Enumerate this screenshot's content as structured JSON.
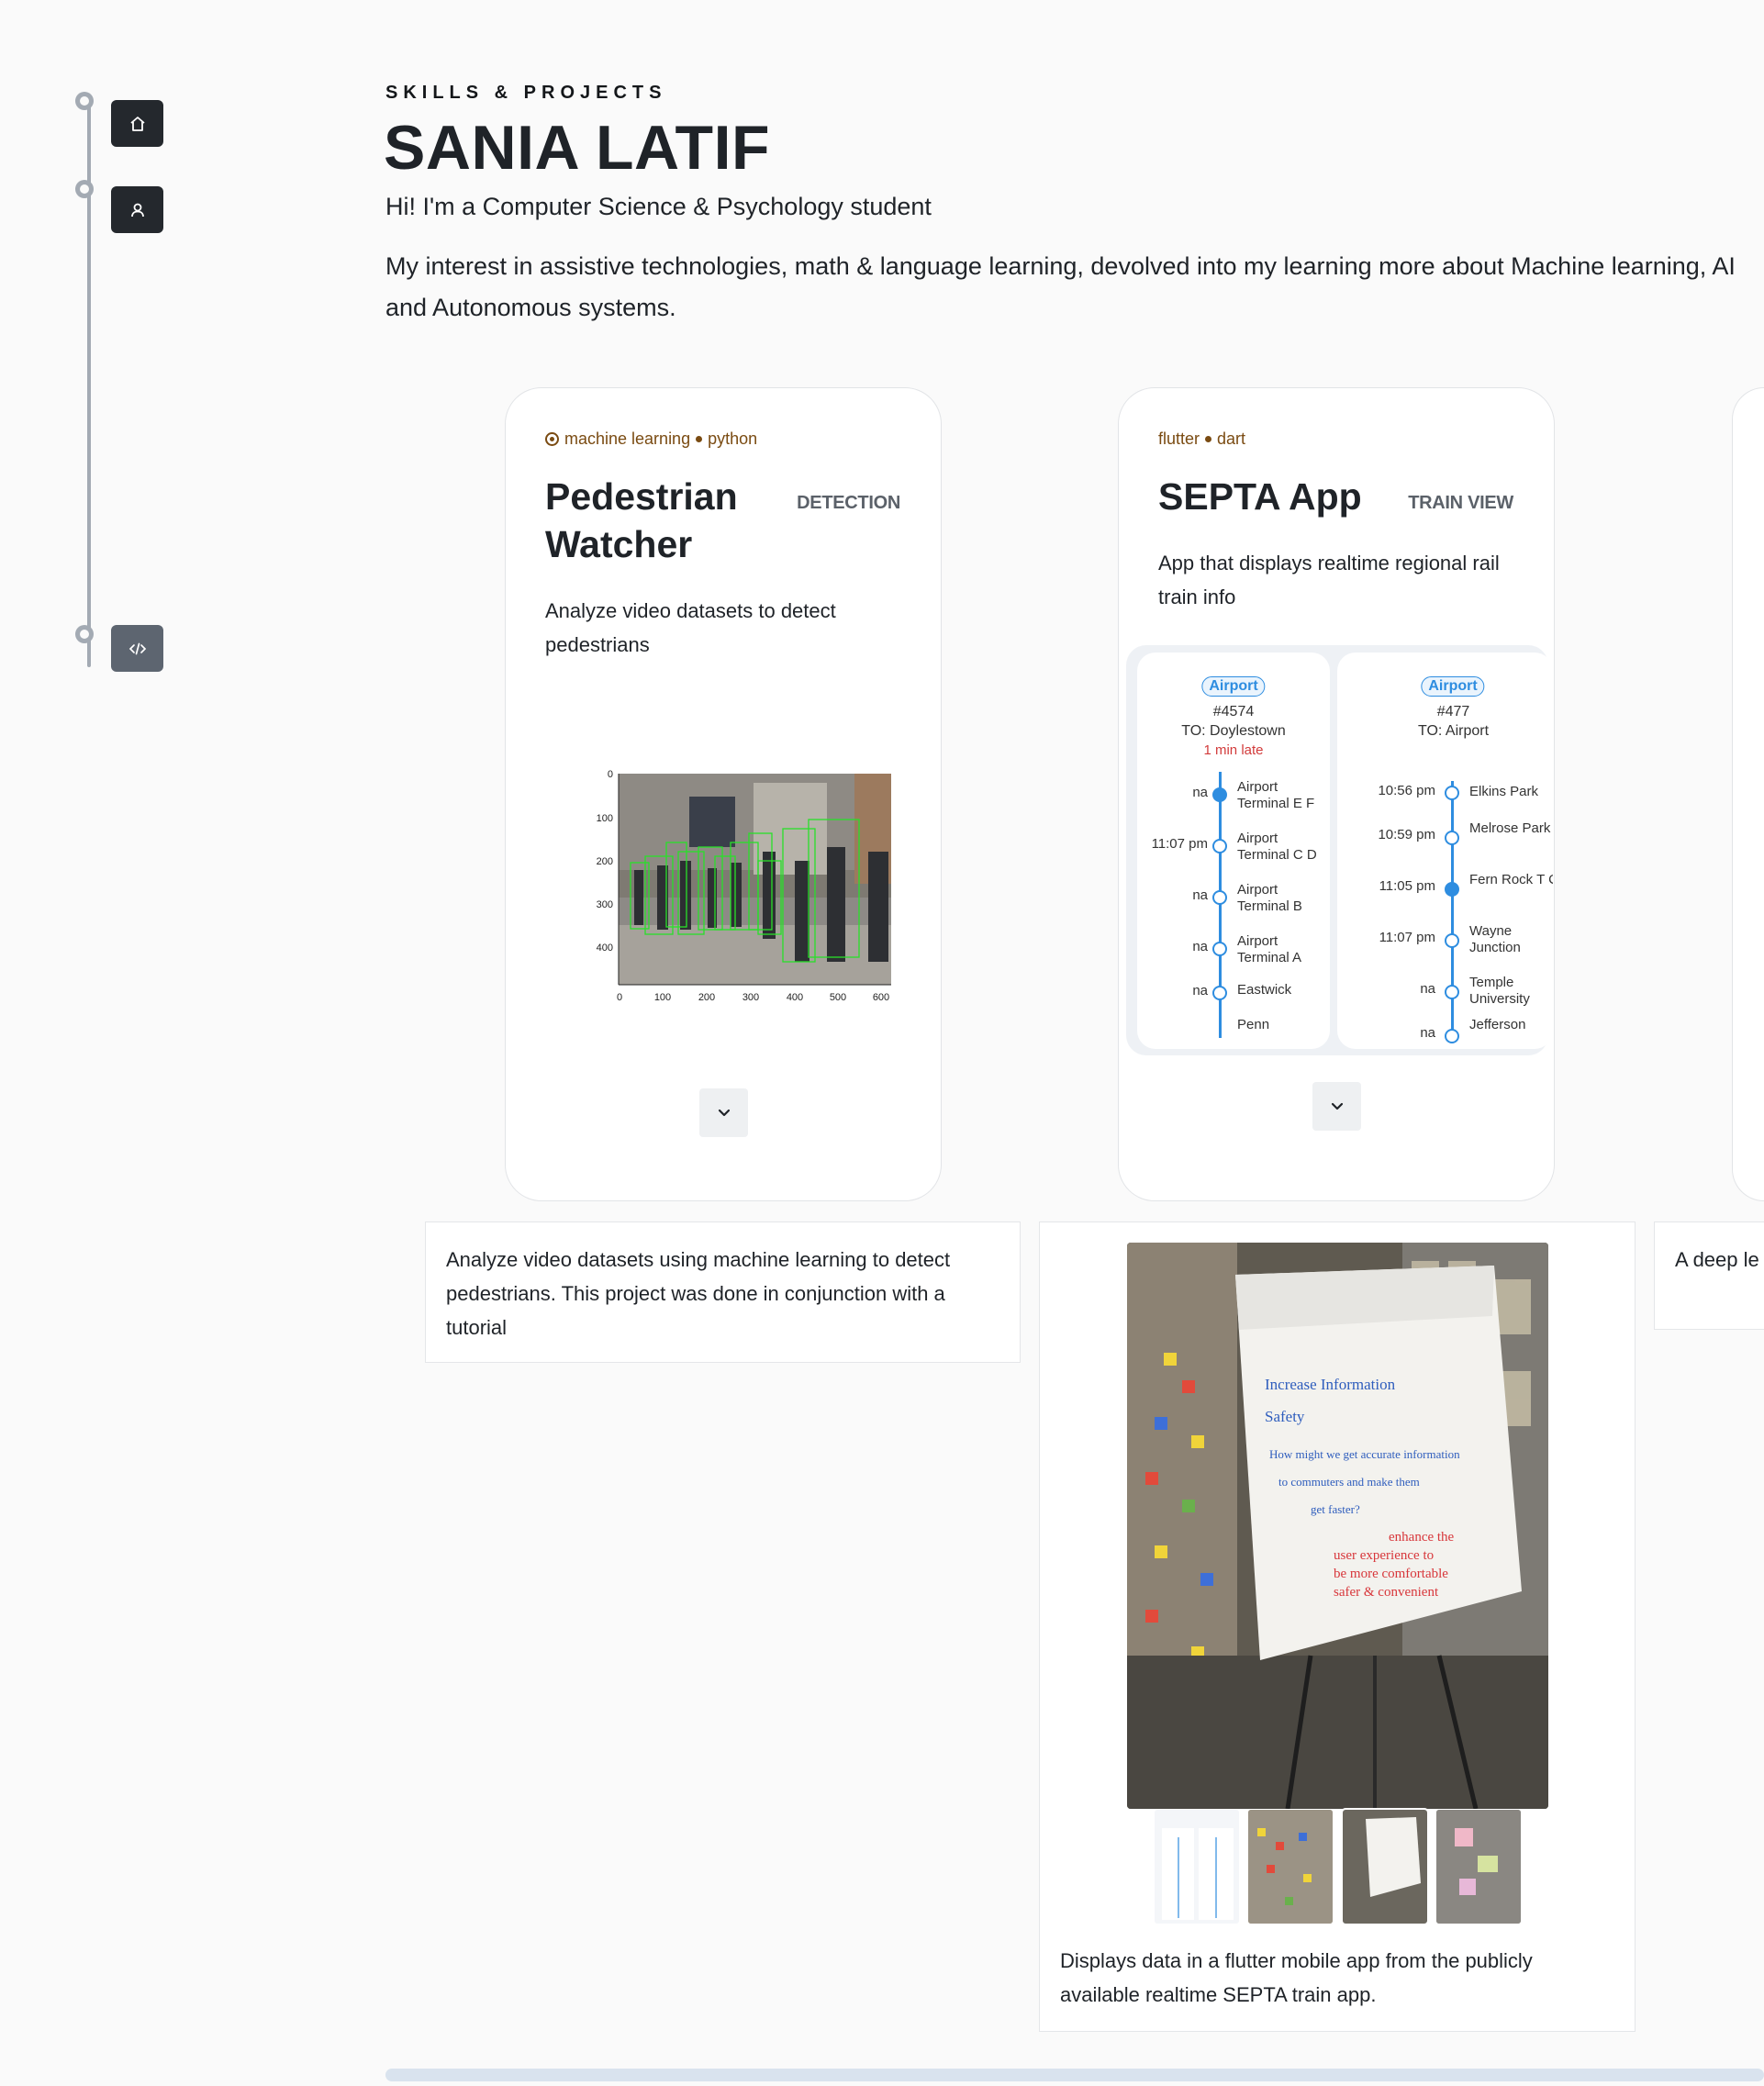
{
  "nav": {
    "items": [
      {
        "name": "home",
        "icon": "home-icon"
      },
      {
        "name": "profile",
        "icon": "person-icon"
      },
      {
        "name": "projects",
        "icon": "code-icon"
      }
    ]
  },
  "header": {
    "kicker": "SKILLS & PROJECTS",
    "title": "SANIA LATIF",
    "subtitle": "Hi! I'm a Computer Science & Psychology student",
    "intro": "My interest in assistive technologies, math & language learning, devolved into my learning more about Machine learning, AI and Autonomous systems."
  },
  "projects": [
    {
      "tags": [
        "machine learning",
        "python"
      ],
      "title": "Pedestrian Watcher",
      "badge": "DETECTION",
      "summary": "Analyze video datasets to detect pedestrians",
      "detail": "Analyze video datasets using machine learning to detect pedestrians. This project was done in conjunction with a tutorial",
      "plot": {
        "y_ticks": [
          "0",
          "100",
          "200",
          "300",
          "400"
        ],
        "x_ticks": [
          "0",
          "100",
          "200",
          "300",
          "400",
          "500",
          "600"
        ]
      }
    },
    {
      "tags": [
        "flutter",
        "dart"
      ],
      "title": "SEPTA App",
      "badge": "TRAIN VIEW",
      "summary": "App that displays realtime regional rail train info",
      "detail": "Displays data in a flutter mobile app from the publicly available realtime SEPTA train app.",
      "trains": [
        {
          "line": "Airport",
          "number": "#4574",
          "to": "TO: Doylestown",
          "status": "1 min late",
          "stops": [
            {
              "time": "na",
              "name": "Airport Terminal E F",
              "current": true
            },
            {
              "time": "11:07 pm",
              "name": "Airport Terminal C D",
              "current": false
            },
            {
              "time": "na",
              "name": "Airport Terminal B",
              "current": false
            },
            {
              "time": "na",
              "name": "Airport Terminal A",
              "current": false
            },
            {
              "time": "na",
              "name": "Eastwick",
              "current": false
            },
            {
              "time": "",
              "name": "Penn",
              "current": false
            }
          ]
        },
        {
          "line": "Airport",
          "number": "#477",
          "to": "TO: Airport",
          "status": "",
          "stops": [
            {
              "time": "10:56 pm",
              "name": "Elkins Park",
              "current": false
            },
            {
              "time": "10:59 pm",
              "name": "Melrose Park",
              "current": false
            },
            {
              "time": "11:05 pm",
              "name": "Fern Rock T C",
              "current": true
            },
            {
              "time": "11:07 pm",
              "name": "Wayne Junction",
              "current": false
            },
            {
              "time": "na",
              "name": "Temple University",
              "current": false
            },
            {
              "time": "na",
              "name": "Jefferson",
              "current": false
            }
          ]
        }
      ],
      "photo_text": {
        "heading": "Increase Information",
        "line2": "Safety",
        "line3": "How might we get accurate information",
        "line4": "to commuters and make them",
        "line5": "get faster?",
        "line6": "enhance the",
        "line7": "user experience to",
        "line8": "be more comfortable",
        "line9": "safer & convenient"
      }
    },
    {
      "detail_partial": "A deep le tutorial, u"
    }
  ],
  "colors": {
    "accent": "#2e8de0",
    "tag": "#7a4b12",
    "late": "#d23b3b",
    "nav_dark": "#24282d"
  }
}
